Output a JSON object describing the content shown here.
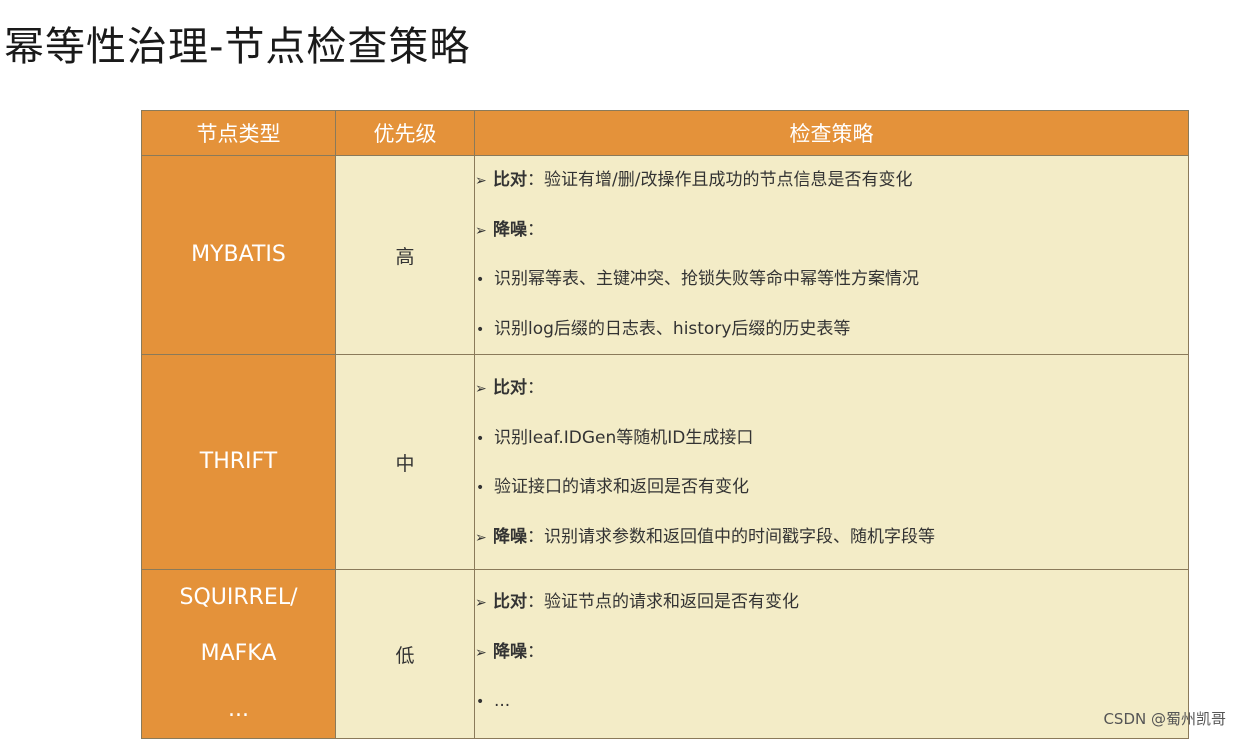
{
  "title": "幂等性治理-节点检查策略",
  "colors": {
    "header_bg": "#e4923a",
    "cell_bg": "#f3ecc7"
  },
  "table": {
    "headers": {
      "type": "节点类型",
      "priority": "优先级",
      "strategy": "检查策略"
    },
    "rows": [
      {
        "type_lines": [
          "MYBATIS"
        ],
        "priority": "高",
        "lines": [
          {
            "bullet": "arrow",
            "bold": "比对",
            "text": "：验证有增/删/改操作且成功的节点信息是否有变化"
          },
          {
            "bullet": "arrow",
            "bold": "降噪",
            "text": "："
          },
          {
            "bullet": "dot",
            "bold": "",
            "text": "识别幂等表、主键冲突、抢锁失败等命中幂等性方案情况"
          },
          {
            "bullet": "dot",
            "bold": "",
            "text": "识别log后缀的日志表、history后缀的历史表等"
          }
        ]
      },
      {
        "type_lines": [
          "THRIFT"
        ],
        "priority": "中",
        "lines": [
          {
            "bullet": "arrow",
            "bold": "比对",
            "text": "："
          },
          {
            "bullet": "dot",
            "bold": "",
            "text": "识别leaf.IDGen等随机ID生成接口"
          },
          {
            "bullet": "dot",
            "bold": "",
            "text": "验证接口的请求和返回是否有变化"
          },
          {
            "bullet": "arrow",
            "bold": "降噪",
            "text": "：识别请求参数和返回值中的时间戳字段、随机字段等"
          }
        ]
      },
      {
        "type_lines": [
          "SQUIRREL/",
          "MAFKA",
          "..."
        ],
        "priority": "低",
        "lines": [
          {
            "bullet": "arrow",
            "bold": "比对",
            "text": "：验证节点的请求和返回是否有变化"
          },
          {
            "bullet": "arrow",
            "bold": "降噪",
            "text": "："
          },
          {
            "bullet": "dot",
            "bold": "",
            "text": "..."
          }
        ]
      }
    ]
  },
  "watermark": "CSDN @蜀州凯哥"
}
